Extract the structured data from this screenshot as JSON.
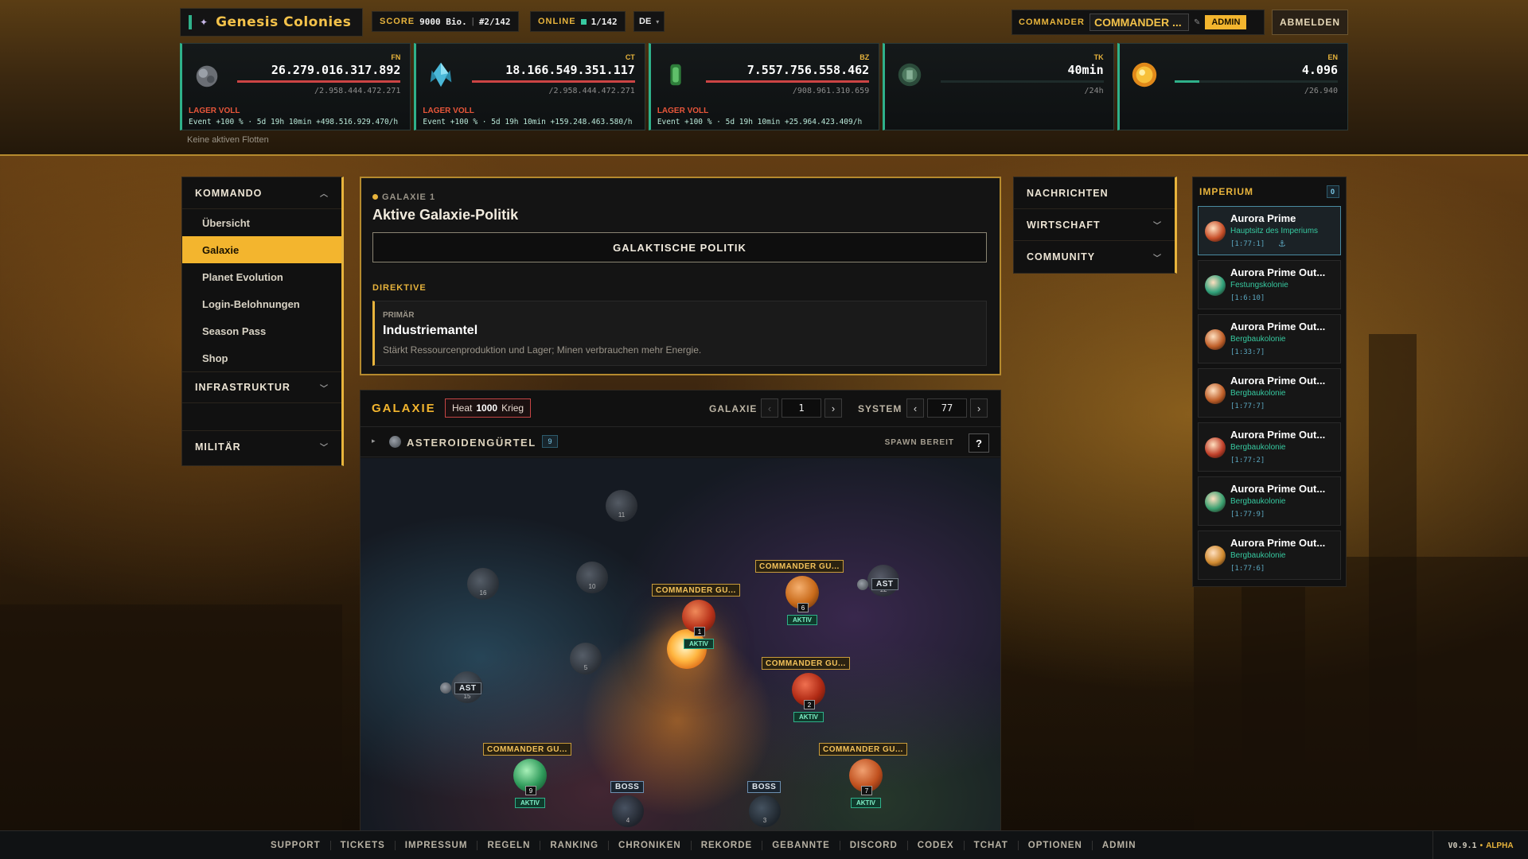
{
  "brand": {
    "title": "Genesis Colonies"
  },
  "header": {
    "score_label": "SCORE",
    "score_value": "9000 Bio.",
    "rank": "#2/142",
    "online_label": "ONLINE",
    "online_value": "1/142",
    "language": "DE",
    "commander_label": "COMMANDER",
    "commander_name": "COMMANDER ...",
    "admin_badge": "ADMIN",
    "logout": "ABMELDEN"
  },
  "resources": [
    {
      "code": "FN",
      "amount": "26.279.016.317.892",
      "capacity": "/2.958.444.472.271",
      "status": "LAGER VOLL",
      "event": "Event +100 % · 5d 19h 10min  +498.516.929.470/h",
      "fill": 1.0,
      "icon": "metal-ore-icon"
    },
    {
      "code": "CT",
      "amount": "18.166.549.351.117",
      "capacity": "/2.958.444.472.271",
      "status": "LAGER VOLL",
      "event": "Event +100 % · 5d 19h 10min  +159.248.463.580/h",
      "fill": 1.0,
      "icon": "crystal-icon"
    },
    {
      "code": "BZ",
      "amount": "7.557.756.558.462",
      "capacity": "/908.961.310.659",
      "status": "LAGER VOLL",
      "event": "Event +100 % · 5d 19h 10min  +25.964.423.409/h",
      "fill": 1.0,
      "icon": "fuel-cell-icon"
    },
    {
      "code": "TK",
      "amount": "40min",
      "capacity": "/24h",
      "status": "",
      "event": "",
      "fill": 0.0,
      "icon": "trooper-badge-icon"
    },
    {
      "code": "EN",
      "amount": "4.096",
      "capacity": "/26.940",
      "status": "",
      "event": "",
      "fill": 0.15,
      "icon": "energy-sun-icon"
    }
  ],
  "fleet_status": "Keine aktiven Flotten",
  "leftnav": {
    "kommando": "KOMMANDO",
    "items": [
      "Übersicht",
      "Galaxie",
      "Planet Evolution",
      "Login-Belohnungen",
      "Season Pass",
      "Shop"
    ],
    "infrastruktur": "INFRASTRUKTUR",
    "militaer": "MILITÄR"
  },
  "politics": {
    "sub": "GALAXIE 1",
    "title": "Aktive Galaxie-Politik",
    "button": "GALAKTISCHE POLITIK",
    "directive_label": "DIREKTIVE",
    "primary_label": "PRIMÄR",
    "primary_name": "Industriemantel",
    "primary_desc": "Stärkt Ressourcenproduktion und Lager; Minen verbrauchen mehr Energie."
  },
  "galaxy": {
    "title": "GALAXIE",
    "heat_label": "Heat",
    "heat_value": "1000",
    "heat_state": "Krieg",
    "galaxy_label": "GALAXIE",
    "galaxy_value": "1",
    "system_label": "SYSTEM",
    "system_value": "77",
    "belt_name": "ASTEROIDENGÜRTEL",
    "belt_count": "9",
    "spawn": "SPAWN BEREIT",
    "help": "?",
    "commander_label": "COMMANDER GU...",
    "aktiv": "AKTIV",
    "ast": "AST",
    "boss": "BOSS",
    "planets": [
      "1",
      "6",
      "2",
      "9",
      "7"
    ],
    "rocks": [
      "11",
      "16",
      "10",
      "12",
      "5",
      "15"
    ],
    "boss_nums": [
      "4",
      "3"
    ]
  },
  "rightmenu": {
    "items": [
      "NACHRICHTEN",
      "WIRTSCHAFT",
      "COMMUNITY"
    ]
  },
  "imperium": {
    "title": "IMPERIUM",
    "badge": "0",
    "colonies": [
      {
        "name": "Aurora Prime",
        "type": "Hauptsitz des Imperiums",
        "coord": "[1:77:1]",
        "color": "#c8502a"
      },
      {
        "name": "Aurora Prime Out...",
        "type": "Festungskolonie",
        "coord": "[1:6:10]",
        "color": "#2fa07a"
      },
      {
        "name": "Aurora Prime Out...",
        "type": "Bergbaukolonie",
        "coord": "[1:33:7]",
        "color": "#c0602a"
      },
      {
        "name": "Aurora Prime Out...",
        "type": "Bergbaukolonie",
        "coord": "[1:77:7]",
        "color": "#c0602a"
      },
      {
        "name": "Aurora Prime Out...",
        "type": "Bergbaukolonie",
        "coord": "[1:77:2]",
        "color": "#c0402a"
      },
      {
        "name": "Aurora Prime Out...",
        "type": "Bergbaukolonie",
        "coord": "[1:77:9]",
        "color": "#3aa070"
      },
      {
        "name": "Aurora Prime Out...",
        "type": "Bergbaukolonie",
        "coord": "[1:77:6]",
        "color": "#d08a30"
      }
    ]
  },
  "footer": {
    "links": [
      "SUPPORT",
      "TICKETS",
      "IMPRESSUM",
      "REGELN",
      "RANKING",
      "CHRONIKEN",
      "REKORDE",
      "GEBANNTE",
      "DISCORD",
      "CODEX",
      "TCHAT",
      "OPTIONEN",
      "ADMIN"
    ],
    "version": "V0.9.1",
    "stage": "ALPHA"
  }
}
